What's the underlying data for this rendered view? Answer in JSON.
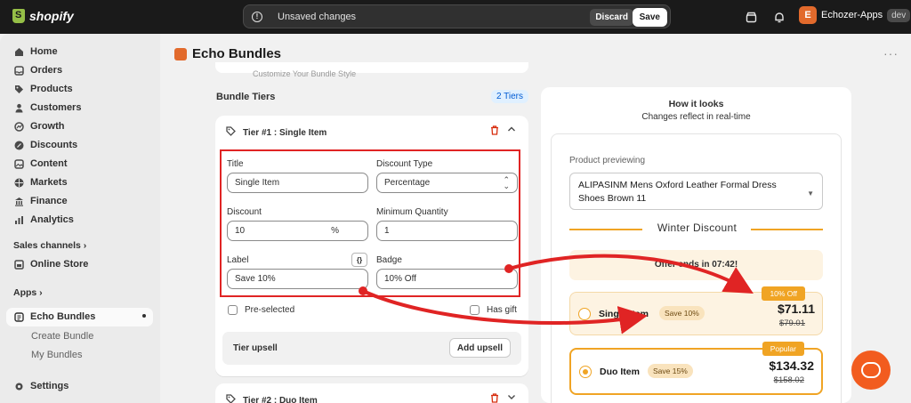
{
  "topbar": {
    "brand": "shopify",
    "unsaved_message": "Unsaved changes",
    "discard_label": "Discard",
    "save_label": "Save",
    "store_initial": "E",
    "store_name": "Echozer-Apps",
    "store_badge": "dev"
  },
  "sidebar": {
    "items": [
      {
        "label": "Home"
      },
      {
        "label": "Orders"
      },
      {
        "label": "Products"
      },
      {
        "label": "Customers"
      },
      {
        "label": "Growth"
      },
      {
        "label": "Discounts"
      },
      {
        "label": "Content"
      },
      {
        "label": "Markets"
      },
      {
        "label": "Finance"
      },
      {
        "label": "Analytics"
      }
    ],
    "sales_channels": "Sales channels",
    "online_store": "Online Store",
    "apps": "Apps",
    "app_name": "Echo Bundles",
    "app_subitems": [
      "Create Bundle",
      "My Bundles"
    ],
    "settings": "Settings"
  },
  "page": {
    "title": "Echo Bundles",
    "faded_text": "Customize Your Bundle Style",
    "tiers_heading": "Bundle Tiers",
    "tiers_badge": "2 Tiers"
  },
  "tier1": {
    "heading": "Tier #1 : Single Item",
    "title_label": "Title",
    "title_value": "Single Item",
    "discount_type_label": "Discount Type",
    "discount_type_value": "Percentage",
    "discount_label": "Discount",
    "discount_value": "10",
    "discount_suffix": "%",
    "min_qty_label": "Minimum Quantity",
    "min_qty_value": "1",
    "label_label": "Label",
    "label_value": "Save 10%",
    "braces": "{}",
    "badge_label": "Badge",
    "badge_value": "10% Off",
    "preselected_label": "Pre-selected",
    "has_gift_label": "Has gift",
    "upsell_label": "Tier upsell",
    "add_upsell_label": "Add upsell"
  },
  "tier2": {
    "heading": "Tier #2 : Duo Item"
  },
  "preview": {
    "title": "How it looks",
    "subtitle": "Changes reflect in real-time",
    "product_label": "Product previewing",
    "product_name": "ALIPASINM Mens Oxford Leather Formal Dress Shoes Brown 11",
    "heading": "Winter Discount",
    "offer_text": "Offer ends in 07:42!",
    "options": [
      {
        "name": "Single Item",
        "pill": "Save 10%",
        "price": "$71.11",
        "compare": "$79.01",
        "tag": "10% Off",
        "selected": false
      },
      {
        "name": "Duo Item",
        "pill": "Save 15%",
        "price": "$134.32",
        "compare": "$158.02",
        "tag": "Popular",
        "selected": true
      }
    ]
  },
  "colors": {
    "accent": "#f0a424",
    "brand": "#e26a2c",
    "annotation": "#e02424"
  }
}
